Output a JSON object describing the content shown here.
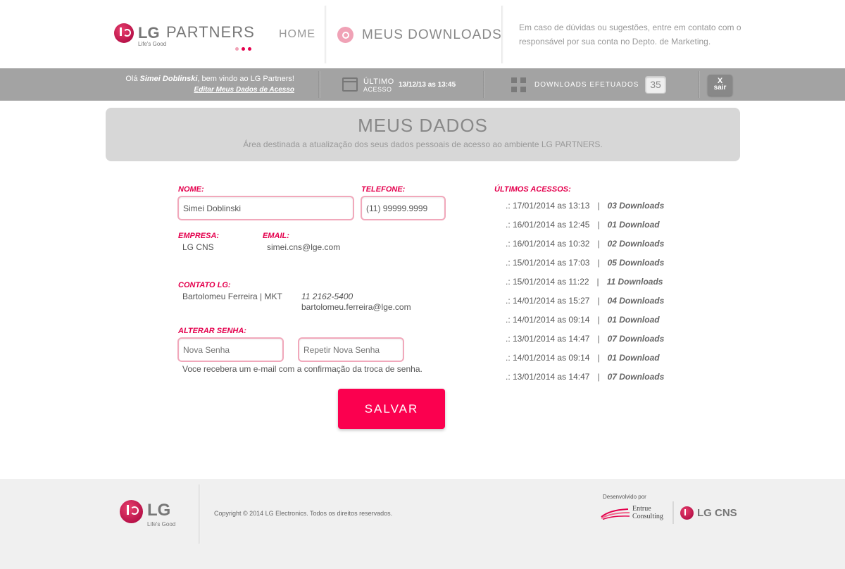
{
  "header": {
    "logo": {
      "brand": "LG",
      "product": "PARTNERS",
      "tagline": "Life's Good",
      "dot_colors": [
        "#f0a2b6",
        "#e4004d",
        "#e4004d"
      ]
    },
    "nav_home": "HOME",
    "nav_downloads": "MEUS DOWNLOADS",
    "help_text": "Em caso de dúvidas ou sugestões, entre em contato com o responsável por sua conta no Depto. de Marketing."
  },
  "status": {
    "welcome_prefix": "Olá",
    "user_name": "Simei Doblinski",
    "welcome_suffix": ", bem vindo ao LG Partners!",
    "edit_link": "Editar Meus Dados de Acesso",
    "last_access_label_1": "ÚLTIMO",
    "last_access_label_2": "ACESSO",
    "last_access_value": "13/12/13 as 13:45",
    "downloads_label": "DOWNLOADS EFETUADOS",
    "downloads_count": "35",
    "logout_x": "X",
    "logout_label": "sair"
  },
  "panel": {
    "title": "MEUS DADOS",
    "subtitle": "Área destinada a atualização dos seus dados pessoais de acesso ao ambiente LG PARTNERS."
  },
  "form": {
    "nome_label": "NOME:",
    "nome_value": "Simei Doblinski",
    "telefone_label": "TELEFONE:",
    "telefone_value": "(11) 99999.9999",
    "empresa_label": "EMPRESA:",
    "empresa_value": "LG CNS",
    "email_label": "EMAIL:",
    "email_value": "simei.cns@lge.com",
    "contato_label": "CONTATO LG:",
    "contato_name": "Bartolomeu Ferreira | MKT",
    "contato_phone": "11 2162-5400",
    "contato_email": "bartolomeu.ferreira@lge.com",
    "senha_label": "ALTERAR SENHA:",
    "nova_senha_placeholder": "Nova Senha",
    "repetir_senha_placeholder": "Repetir Nova Senha",
    "note": "Voce recebera um e-mail com a confirmação da troca de senha.",
    "save_label": "SALVAR"
  },
  "accesses": {
    "title": "ÚLTIMOS ACESSOS:",
    "rows": [
      {
        "date": ".: 17/01/2014 as 13:13",
        "sep": "|",
        "downloads": "03 Downloads"
      },
      {
        "date": ".: 16/01/2014 as 12:45",
        "sep": "|",
        "downloads": "01 Download"
      },
      {
        "date": ".: 16/01/2014 as 10:32",
        "sep": "|",
        "downloads": "02 Downloads"
      },
      {
        "date": ".: 15/01/2014 as 17:03",
        "sep": "|",
        "downloads": "05 Downloads"
      },
      {
        "date": ".: 15/01/2014 as 11:22",
        "sep": "|",
        "downloads": "11 Downloads"
      },
      {
        "date": ".: 14/01/2014 as 15:27",
        "sep": "|",
        "downloads": "04 Downloads"
      },
      {
        "date": ".: 14/01/2014 as 09:14",
        "sep": "|",
        "downloads": "01 Download"
      },
      {
        "date": ".: 13/01/2014 as 14:47",
        "sep": "|",
        "downloads": "07 Downloads"
      },
      {
        "date": ".: 14/01/2014 as 09:14",
        "sep": "|",
        "downloads": "01 Download"
      },
      {
        "date": ".: 13/01/2014 as 14:47",
        "sep": "|",
        "downloads": "07 Downloads"
      }
    ]
  },
  "footer": {
    "logo_brand": "LG",
    "logo_tagline": "Life's Good",
    "copyright": "Copyright © 2014 LG Electronics. Todos os direitos reservados.",
    "developed_by": "Desenvolvido por",
    "entrue_line1": "Entrue",
    "entrue_line2": "Consulting",
    "lgcns": "LG CNS"
  },
  "colors": {
    "accent": "#e4004d",
    "save_button": "#fb004f",
    "status_bar": "#a3a3a3",
    "panel": "#d7d7d7",
    "footer": "#f0f0f0"
  }
}
